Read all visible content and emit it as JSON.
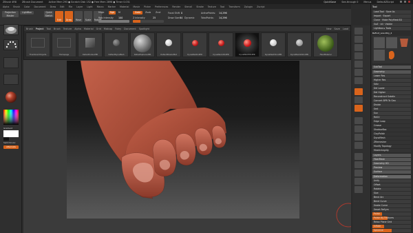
{
  "window": {
    "title_left": "ZBrush 4R8",
    "title_doc": "ZBrush Document",
    "title_stats": "Active Mem 293 ● Scratch Disk 152 ● Free Mem 2898 ● Timer 0.031",
    "quick_save": "QuickSave",
    "see_through": "See-through 0",
    "menus_label": "Menus",
    "default_script": "DefaultZScript"
  },
  "menubar": [
    "Alpha",
    "Brush",
    "Color",
    "Document",
    "Draw",
    "Edit",
    "File",
    "Layer",
    "Light",
    "Macro",
    "Marker",
    "Material",
    "Movie",
    "Picker",
    "Preferences",
    "Render",
    "Stencil",
    "Stroke",
    "Texture",
    "Tool",
    "Transform",
    "Zplugin",
    "Zscript"
  ],
  "topshelf": {
    "projection_master": "Projection Master",
    "lightbox": "LightBox",
    "quick_sketch": "Quick Sketch",
    "edit": "Edit",
    "draw": "Draw",
    "move": "Move",
    "scale": "Scale",
    "rotate": "Rotate",
    "mrgb": "Mrgb",
    "rgb": "Rgb",
    "m": "M",
    "zadd": "Zadd",
    "zsub": "Zsub",
    "zcut": "Zcut",
    "rgb_intensity_label": "Rgb Intensity",
    "rgb_intensity": "100",
    "rgb_intensity_pct": 1.0,
    "z_intensity_label": "Z Intensity",
    "z_intensity": "25",
    "z_intensity_pct": 0.25,
    "focal_shift_label": "Focal Shift",
    "focal_shift": "0",
    "draw_size_label": "Draw Size",
    "draw_size": "64",
    "dynamic": "Dynamic",
    "active_points_label": "ActivePoints:",
    "active_points": "14,296",
    "total_points_label": "TotalPoints:",
    "total_points": "14,296"
  },
  "popup": {
    "tabs": [
      "Brush",
      "Project",
      "Tool",
      "Brush",
      "Texture",
      "Alpha",
      "Material",
      "Grid",
      "Matcap",
      "Foley",
      "Document",
      "Spotlight"
    ],
    "active_tab_index": 1,
    "right_buttons": [
      "New",
      "Save",
      "Load"
    ],
    "thumbs": [
      {
        "label": "Thumbnail Projects",
        "kind": "empty"
      },
      {
        "label": "Homepage",
        "kind": "empty"
      },
      {
        "label": "DefaultCube.ZPR",
        "kind": "cube"
      },
      {
        "label": "DefaultDynaMesh",
        "kind": "sphere-dark"
      },
      {
        "label": "DefaultSphere.ZPR",
        "kind": "sphere-big"
      },
      {
        "label": "DefaultShaderMat",
        "kind": "sphere-white"
      },
      {
        "label": "DynaWax64.ZPR",
        "kind": "sphere-red"
      },
      {
        "label": "DynaWax128.ZPR",
        "kind": "sphere-red"
      },
      {
        "label": "DynaWax256.ZPR",
        "kind": "sphere-red-glow"
      },
      {
        "label": "DynaMesh512.ZPR",
        "kind": "sphere-white"
      },
      {
        "label": "DynaMesh1024.ZPR",
        "kind": "sphere-grey"
      },
      {
        "label": "FiberMaterial",
        "kind": "fiber"
      }
    ]
  },
  "lefttray": {
    "gradient": "Gradient",
    "switch_color": "SwitchColor",
    "alternate": "Alternate"
  },
  "righttray": {
    "title": "Tool",
    "rows": [
      [
        "Load Tool",
        "Save As"
      ],
      [
        "Import",
        "Export"
      ],
      [
        "Clone",
        "Make PolyMesh3D"
      ],
      [
        "GoZ",
        "All",
        "Visible",
        "R"
      ],
      [
        "Lightbox ▸ Tools"
      ]
    ],
    "tool_label": "ReFoot_Low-Poly_4",
    "tool_count": "R",
    "subtool": "SubTool",
    "geometry": "Geometry",
    "geometry_items": [
      "Lower Res",
      "Higher Res",
      "Sdiv",
      "Del Lower",
      "Del Higher",
      "Reconstruct Subdiv",
      "Convert BPR To Geo",
      "Divide",
      "Smt",
      "Suv",
      "ReUV"
    ],
    "sections": [
      "Edge Loop",
      "Crease",
      "ShadowBox",
      "ClayPolish",
      "DynaMesh",
      "ZRemesher",
      "Modify Topology",
      "MeshIntegrity"
    ],
    "more_sections": [
      "Layers",
      "FiberMesh",
      "Geometry HD",
      "Preview",
      "Surface"
    ],
    "deformation": "Deformation",
    "deform_rows": [
      {
        "label": "Unify",
        "fill": 0.0
      },
      {
        "label": "Offset",
        "fill": 0.0
      },
      {
        "label": "Rotate",
        "fill": 0.0
      },
      {
        "label": "Size",
        "fill": 0.0
      },
      {
        "label": "Bend Arc",
        "fill": 0.0
      },
      {
        "label": "Bend Curve",
        "fill": 0.0
      },
      {
        "label": "Snake Curve",
        "fill": 0.0
      },
      {
        "label": "Smart ReSym",
        "fill": 0.0
      },
      {
        "label": "Polish",
        "fill": 0.25
      },
      {
        "label": "Polish By Features",
        "fill": 0.4
      },
      {
        "label": "Relax Plane Grid",
        "fill": 0.0
      },
      {
        "label": "Inflate",
        "fill": 0.3
      },
      {
        "label": "Spherize",
        "fill": 0.5
      }
    ]
  },
  "colors": {
    "accent": "#d9641c",
    "skin": "#a34a36",
    "panel": "#2f2f2f",
    "canvas_bg": "#3b3b3b"
  }
}
